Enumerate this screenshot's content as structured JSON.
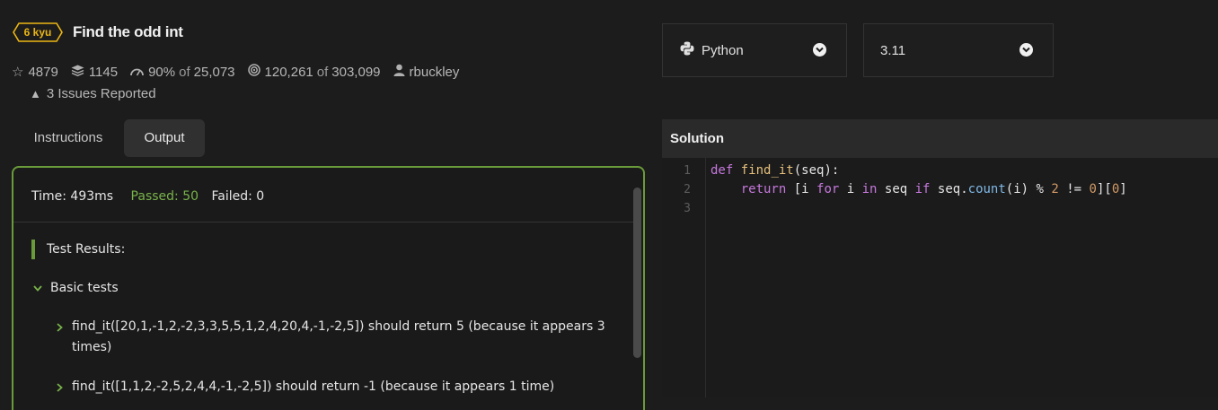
{
  "kata": {
    "rank": "6 kyu",
    "title": "Find the odd int",
    "rank_color": "#ecb613",
    "stats": {
      "stars": "4879",
      "collections": "1145",
      "satisfaction_pct": "90%",
      "satisfaction_of": "of",
      "satisfaction_total": "25,073",
      "completed": "120,261",
      "completed_of": "of",
      "completed_total": "303,099",
      "author": "rbuckley"
    },
    "issues": "3 Issues Reported"
  },
  "tabs": [
    {
      "label": "Instructions",
      "active": false
    },
    {
      "label": "Output",
      "active": true
    }
  ],
  "output": {
    "time": "Time: 493ms",
    "passed": "Passed: 50",
    "failed": "Failed: 0",
    "results_heading": "Test Results:",
    "group": "Basic tests",
    "tests": [
      "find_it([20,1,-1,2,-2,3,3,5,5,1,2,4,20,4,-1,-2,5]) should return 5 (because it appears 3 times)",
      "find_it([1,1,2,-2,5,2,4,4,-1,-2,5]) should return -1 (because it appears 1 time)"
    ],
    "accent_color": "#6a9b3b"
  },
  "language_select": {
    "value": "Python",
    "icon": "python-icon"
  },
  "version_select": {
    "value": "3.11"
  },
  "solution": {
    "heading": "Solution",
    "line_numbers": [
      "1",
      "2",
      "3"
    ]
  }
}
